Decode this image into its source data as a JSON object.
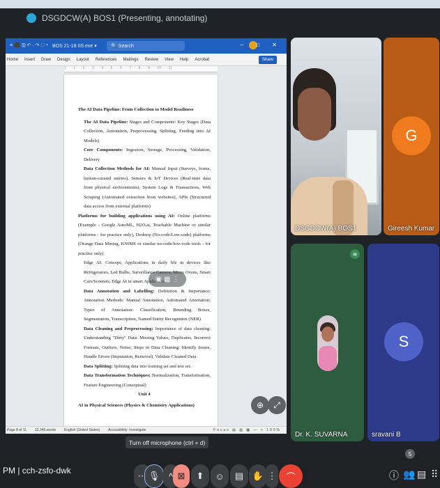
{
  "banner": {
    "text": "DSGDCW(A) BOS1 (Presenting, annotating)"
  },
  "word": {
    "quick_access": "≡ ⬛ 🖫 ↶ · ↷ ⬚ ▾",
    "doc_name": "BOS 21-18 IIS.exe ▾",
    "search_placeholder": "Search",
    "window_controls": "– □ ✕",
    "menu": [
      "Home",
      "Insert",
      "Draw",
      "Design",
      "Layout",
      "References",
      "Mailings",
      "Review",
      "View",
      "Help",
      "Acrobat"
    ],
    "share": "Share",
    "ruler": "1 · · · 1 · · · 2 · · · 3 · · · 4 · · · 5 · · · 6 · · · 7 · · · 8 · · · 9 · · · 10 · · · 11",
    "status": [
      "Page 8 of 11",
      "12,345 words",
      "English (United States)",
      "Accessibility: Investigate"
    ],
    "status_right": "Focus ▤ ▥ ▦ — + 100%"
  },
  "document": {
    "heading": "The AI Data Pipeline: From Collection to Model Readiness",
    "p1_b": "The AI Data Pipeline:",
    "p1": " Stages and Components: Key Stages (Data Collection, Annotation, Preprocessing, Splitting, Feeding into AI Models)",
    "p2_b": "Core Components:",
    "p2": " Ingestion, Storage, Processing, Validation, Delivery",
    "p3_b": "Data Collection Methods for AI:",
    "p3": " Manual Input (Surveys, forms, human-curated entries), Sensors & IoT Devices (Real-time data from physical environments), System Logs & Transactions, Web Scraping (Automated extraction from websites), APIs (Structured data access from external platforms)",
    "p4_b": "Platforms for building applications using AI:",
    "p4": " Online platforms (Example - Google AutoML, H2O.ai, Teachable Machine or similar platforms - for practice only), Desktop (No-code/Low-code) platforms (Orange Data Mining, KNIME or similar no-code/low-code tools - for practice only)",
    "p5": "Edge AI: Concept; Applications in daily life in devices like Refrigerators, Led Bulbs, Surveillance Camera, Micro Ovens, Smart Cars/Scooters; Edge AI in smart Appliances",
    "p6_b": "Data Annotation and Labelling:",
    "p6": " Definition & Importance; Annotation Methods: Manual Annotation, Automated Annotation; Types of Annotation: Classification, Bounding Boxes, Segmentation, Transcription, Named Entity Recognition (NER)",
    "p7_b": "Data Cleaning and Preprocessing:",
    "p7": " Importance of data cleaning: Understanding \"Dirty\" Data: Missing Values, Duplicates, Incorrect Formats, Outliers, Noise; Steps in Data Cleaning: Identify Issues, Handle Errors (Imputation, Removal), Validate Cleaned Data",
    "p8_b": "Data Splitting:",
    "p8": " Splitting data into training set and test set.",
    "p9_b": "Data Transformation Techniques:",
    "p9": " Normalization, Transformation, Feature Engineering (Conceptual)",
    "unit": "Unit 4",
    "unit_title": "AI in Physical Sciences (Physics & Chemistry Applications)"
  },
  "participants": [
    {
      "name": "DSGDCW(A) BOS1"
    },
    {
      "name": "Gireesh Kumar",
      "initial": "G",
      "color": "#b85b16"
    },
    {
      "name": "Dr. K. SUVARNA"
    },
    {
      "name": "sravani B",
      "initial": "S",
      "color": "#2d3a8a"
    }
  ],
  "meeting": {
    "time_code": "PM | cch-zsfo-dwk",
    "tooltip": "Turn off microphone (ctrl + d)",
    "people_count": "5"
  },
  "icons": {
    "dots": "⋯",
    "mic": "🎙",
    "up": "^",
    "cam_off": "⊠",
    "present": "⬆",
    "emoji": "☺",
    "cc": "▤",
    "hand": "✋",
    "more": "⋮",
    "leave": "⌒",
    "info": "ⓘ",
    "people": "👥",
    "chat": "▤",
    "activities": "⠿",
    "zoom": "⊕",
    "expand": "⤢"
  },
  "overlay": {
    "pill": "▣ ▦ ⋮"
  }
}
